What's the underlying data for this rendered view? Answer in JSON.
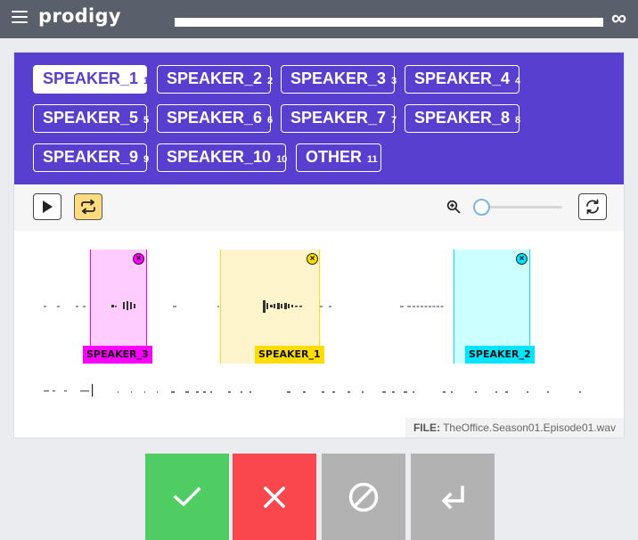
{
  "app": {
    "logo": "prodigy",
    "infinity_symbol": "∞",
    "progress": 1.0
  },
  "labels": [
    {
      "name": "SPEAKER_1",
      "key": "1",
      "selected": true
    },
    {
      "name": "SPEAKER_2",
      "key": "2",
      "selected": false
    },
    {
      "name": "SPEAKER_3",
      "key": "3",
      "selected": false
    },
    {
      "name": "SPEAKER_4",
      "key": "4",
      "selected": false
    },
    {
      "name": "SPEAKER_5",
      "key": "5",
      "selected": false
    },
    {
      "name": "SPEAKER_6",
      "key": "6",
      "selected": false
    },
    {
      "name": "SPEAKER_7",
      "key": "7",
      "selected": false
    },
    {
      "name": "SPEAKER_8",
      "key": "8",
      "selected": false
    },
    {
      "name": "SPEAKER_9",
      "key": "9",
      "selected": false
    },
    {
      "name": "SPEAKER_10",
      "key": "10",
      "selected": false
    },
    {
      "name": "OTHER",
      "key": "11",
      "selected": false
    }
  ],
  "toolbar": {
    "play_icon": "play-icon",
    "loop_icon": "loop-icon",
    "loop_active": true,
    "zoom_icon": "zoom-in-icon",
    "zoom_level": 0.0,
    "refresh_icon": "refresh-icon"
  },
  "regions": [
    {
      "label": "SPEAKER_3",
      "fill": "#ffccff",
      "accent": "#ff00ff",
      "close": "×"
    },
    {
      "label": "SPEAKER_1",
      "fill": "#fff5cc",
      "accent": "#ffdd00",
      "close": "×"
    },
    {
      "label": "SPEAKER_2",
      "fill": "#ccffff",
      "accent": "#00e5ff",
      "close": "×"
    }
  ],
  "file": {
    "prefix": "FILE:",
    "name": "TheOffice.Season01.Episode01.wav"
  },
  "answers": {
    "accept_icon": "check-icon",
    "reject_icon": "x-icon",
    "ignore_icon": "no-entry-icon",
    "undo_icon": "undo-icon"
  },
  "colors": {
    "header": "#59606b",
    "label_bar": "#583fcf",
    "accept": "#4fcd63",
    "reject": "#f9474d",
    "neutral": "#b2b2b2"
  }
}
